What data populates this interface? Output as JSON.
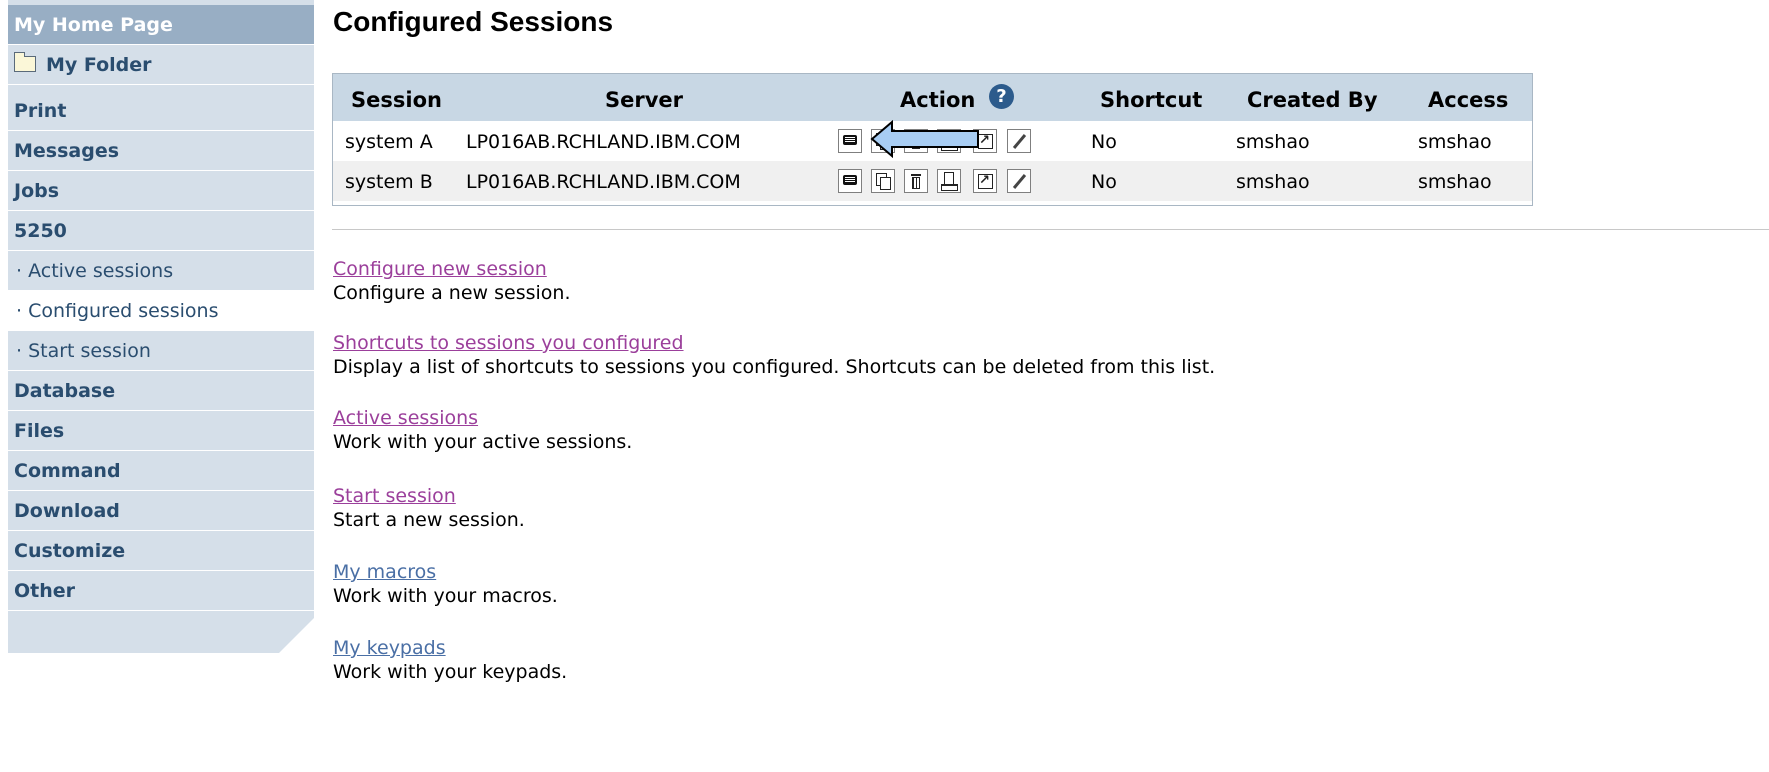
{
  "sidebar": {
    "home": "My Home Page",
    "folder": "My Folder",
    "items": [
      {
        "label": "Print"
      },
      {
        "label": "Messages"
      },
      {
        "label": "Jobs"
      },
      {
        "label": "5250"
      },
      {
        "label": "· Active sessions"
      },
      {
        "label": "· Configured sessions",
        "selected": true
      },
      {
        "label": "· Start session"
      },
      {
        "label": "Database"
      },
      {
        "label": "Files"
      },
      {
        "label": "Command"
      },
      {
        "label": "Download"
      },
      {
        "label": "Customize"
      },
      {
        "label": "Other"
      }
    ]
  },
  "page": {
    "title": "Configured Sessions"
  },
  "table": {
    "headers": {
      "session": "Session",
      "server": "Server",
      "action": "Action",
      "shortcut": "Shortcut",
      "created_by": "Created By",
      "access": "Access"
    },
    "rows": [
      {
        "session": "system A",
        "server": "LP016AB.RCHLAND.IBM.COM",
        "shortcut": "No",
        "created_by": "smshao",
        "access": "smshao"
      },
      {
        "session": "system B",
        "server": "LP016AB.RCHLAND.IBM.COM",
        "shortcut": "No",
        "created_by": "smshao",
        "access": "smshao"
      }
    ],
    "action_icons": [
      "open-session-icon",
      "copy-icon",
      "delete-icon",
      "print-icon",
      "shortcut-icon",
      "edit-icon"
    ]
  },
  "links": [
    {
      "label": "Configure new session",
      "desc": "Configure a new session."
    },
    {
      "label": "Shortcuts to sessions you configured",
      "desc": "Display a list of shortcuts to sessions you configured. Shortcuts can be deleted from this list."
    },
    {
      "label": "Active sessions",
      "desc": "Work with your active sessions."
    },
    {
      "label": "Start session",
      "desc": "Start a new session."
    },
    {
      "label": "My macros",
      "desc": "Work with your macros."
    },
    {
      "label": "My keypads",
      "desc": "Work with your keypads."
    }
  ],
  "colors": {
    "sidebar_bg": "#d5dfe9",
    "sidebar_home": "#98aec4",
    "nav_text": "#2a4d6f",
    "table_header": "#c8d7e4",
    "visited_link": "#9b3f9b",
    "link": "#4a6fa5",
    "callout_arrow": "#a8cdf3"
  }
}
